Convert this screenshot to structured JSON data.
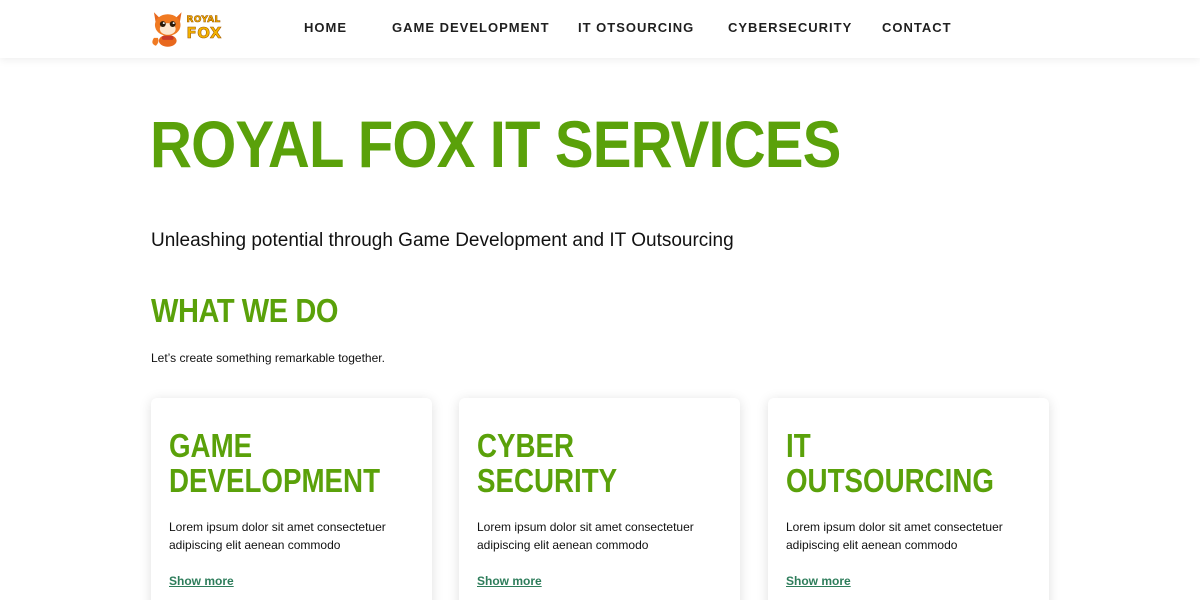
{
  "brand": {
    "logo_line1": "ROYAL",
    "logo_line2": "FOX",
    "logo_icon": "fox-mascot-icon"
  },
  "nav": {
    "items": [
      {
        "label": "HOME"
      },
      {
        "label": "GAME DEVELOPMENT"
      },
      {
        "label": "IT OTSOURCING"
      },
      {
        "label": "CYBERSECURITY"
      },
      {
        "label": "CONTACT"
      }
    ]
  },
  "hero": {
    "title": "ROYAL FOX IT SERVICES",
    "tagline": "Unleashing potential through Game Development and IT Outsourcing"
  },
  "what_we_do": {
    "title": "WHAT WE DO",
    "subtitle": "Let’s create something remarkable together."
  },
  "cards": [
    {
      "title_line1": "GAME",
      "title_line2": "DEVELOPMENT",
      "body": "Lorem ipsum dolor sit amet consectetuer adipiscing elit aenean commodo",
      "link": "Show more"
    },
    {
      "title_line1": "CYBER",
      "title_line2": "SECURITY",
      "body": "Lorem ipsum dolor sit amet consectetuer adipiscing elit aenean commodo",
      "link": "Show more"
    },
    {
      "title_line1": "IT",
      "title_line2": "OUTSOURCING",
      "body": "Lorem ipsum dolor sit amet consectetuer adipiscing elit aenean commodo",
      "link": "Show more"
    }
  ],
  "colors": {
    "accent_green": "#5aa10a",
    "link_green": "#2e7d5b",
    "logo_gold": "#f5b400"
  }
}
